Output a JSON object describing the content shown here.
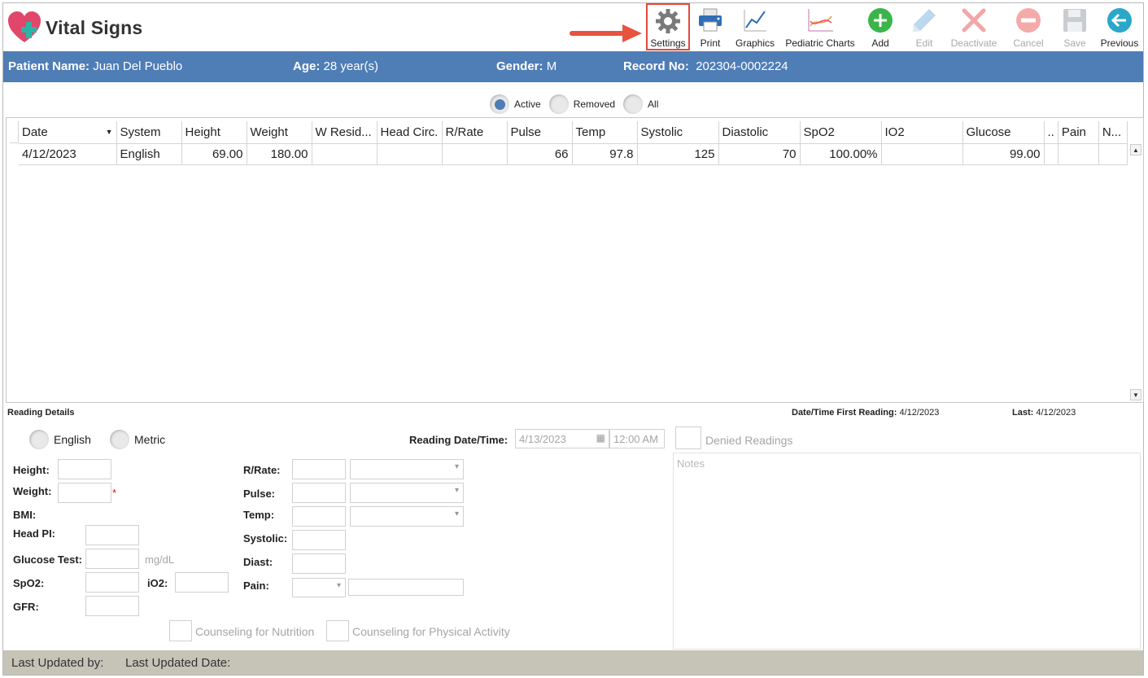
{
  "app": {
    "title": "Vital Signs"
  },
  "toolbar": {
    "settings": "Settings",
    "print": "Print",
    "graphics": "Graphics",
    "pediatric": "Pediatric Charts",
    "add": "Add",
    "edit": "Edit",
    "deactivate": "Deactivate",
    "cancel": "Cancel",
    "save": "Save",
    "previous": "Previous"
  },
  "patient": {
    "name_label": "Patient Name:",
    "name": "Juan Del Pueblo",
    "age_label": "Age:",
    "age": "28 year(s)",
    "gender_label": "Gender:",
    "gender": "M",
    "record_label": "Record No:",
    "record": "202304-0002224"
  },
  "filters": {
    "active": "Active",
    "removed": "Removed",
    "all": "All",
    "selected": "Active"
  },
  "grid": {
    "columns": [
      "Date",
      "System",
      "Height",
      "Weight",
      "W Resid...",
      "Head Circ.",
      "R/Rate",
      "Pulse",
      "Temp",
      "Systolic",
      "Diastolic",
      "SpO2",
      "IO2",
      "Glucose",
      "..",
      "Pain",
      "N..."
    ],
    "rows": [
      [
        "4/12/2023",
        "English",
        "69.00",
        "180.00",
        "",
        "",
        "",
        "66",
        "97.8",
        "125",
        "70",
        "100.00%",
        "",
        "99.00",
        "",
        "",
        ""
      ]
    ]
  },
  "details": {
    "section_label": "Reading Details",
    "first_reading_label": "Date/Time First Reading:",
    "first_reading": "4/12/2023",
    "last_label": "Last:",
    "last": "4/12/2023",
    "system_english": "English",
    "system_metric": "Metric",
    "reading_datetime_label": "Reading Date/Time:",
    "reading_date": "4/13/2023",
    "reading_time": "12:00 AM",
    "denied_readings": "Denied Readings",
    "notes_placeholder": "Notes",
    "height_label": "Height:",
    "weight_label": "Weight:",
    "required_mark": "*",
    "bmi_label": "BMI:",
    "headpi_label": "Head PI:",
    "glucose_label": "Glucose Test:",
    "glucose_unit": "mg/dL",
    "spo2_label": "SpO2:",
    "io2_label": "iO2:",
    "gfr_label": "GFR:",
    "rrate_label": "R/Rate:",
    "pulse_label": "Pulse:",
    "temp_label": "Temp:",
    "systolic_label": "Systolic:",
    "diast_label": "Diast:",
    "pain_label": "Pain:",
    "counseling_nutrition": "Counseling for Nutrition",
    "counseling_activity": "Counseling for Physical Activity"
  },
  "footer": {
    "updated_by_label": "Last Updated by:",
    "updated_date_label": "Last Updated Date:"
  },
  "colors": {
    "header_bar": "#4f7db6",
    "selection": "#e04a3b",
    "footer": "#c6c3b7"
  }
}
